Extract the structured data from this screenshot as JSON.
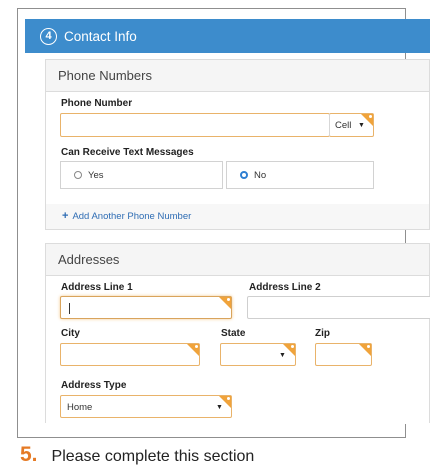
{
  "section": {
    "step": "4",
    "title": "Contact Info"
  },
  "phone": {
    "heading": "Phone Numbers",
    "number_label": "Phone Number",
    "number_value": "",
    "type_select": "Cell",
    "text_label": "Can Receive Text Messages",
    "options": [
      {
        "label": "Yes",
        "checked": false
      },
      {
        "label": "No",
        "checked": true
      }
    ],
    "add_link": "Add Another Phone Number"
  },
  "addresses": {
    "heading": "Addresses",
    "line1_label": "Address Line 1",
    "line2_label": "Address Line 2",
    "city_label": "City",
    "state_label": "State",
    "zip_label": "Zip",
    "type_label": "Address Type",
    "type_value": "Home"
  },
  "caption": {
    "number": "5.",
    "text": "Please complete this section"
  },
  "colors": {
    "header": "#3d8ccc",
    "required": "#f0a33b",
    "link": "#2f6db4",
    "radio": "#2e7fd2",
    "step_number": "#e57a25"
  }
}
